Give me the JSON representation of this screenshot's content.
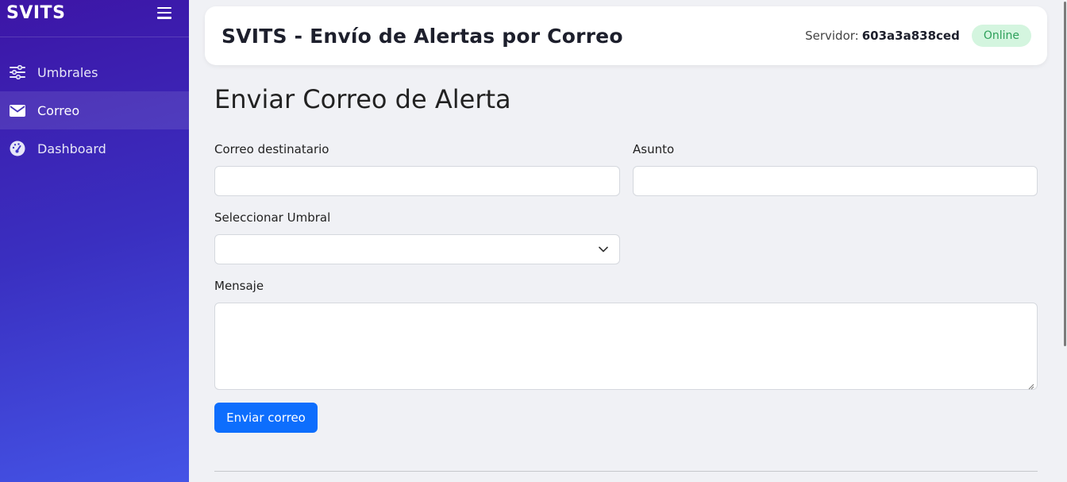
{
  "sidebar": {
    "brand": "SVITS",
    "items": [
      {
        "label": "Umbrales",
        "icon": "sliders-icon",
        "active": false
      },
      {
        "label": "Correo",
        "icon": "envelope-icon",
        "active": true
      },
      {
        "label": "Dashboard",
        "icon": "gauge-icon",
        "active": false
      }
    ]
  },
  "header": {
    "title": "SVITS - Envío de Alertas por Correo",
    "server_label": "Servidor:",
    "server_id": "603a3a838ced",
    "status": "Online"
  },
  "main": {
    "page_title": "Enviar Correo de Alerta",
    "recipient": {
      "label": "Correo destinatario",
      "value": ""
    },
    "subject": {
      "label": "Asunto",
      "value": ""
    },
    "threshold": {
      "label": "Seleccionar Umbral",
      "selected": ""
    },
    "message": {
      "label": "Mensaje",
      "value": ""
    },
    "send_label": "Enviar correo"
  },
  "colors": {
    "sidebar_start": "#3d15a6",
    "sidebar_end": "#4454e6",
    "primary": "#0d6efd",
    "status_bg": "#d4f5df",
    "status_text": "#2ea05a"
  }
}
